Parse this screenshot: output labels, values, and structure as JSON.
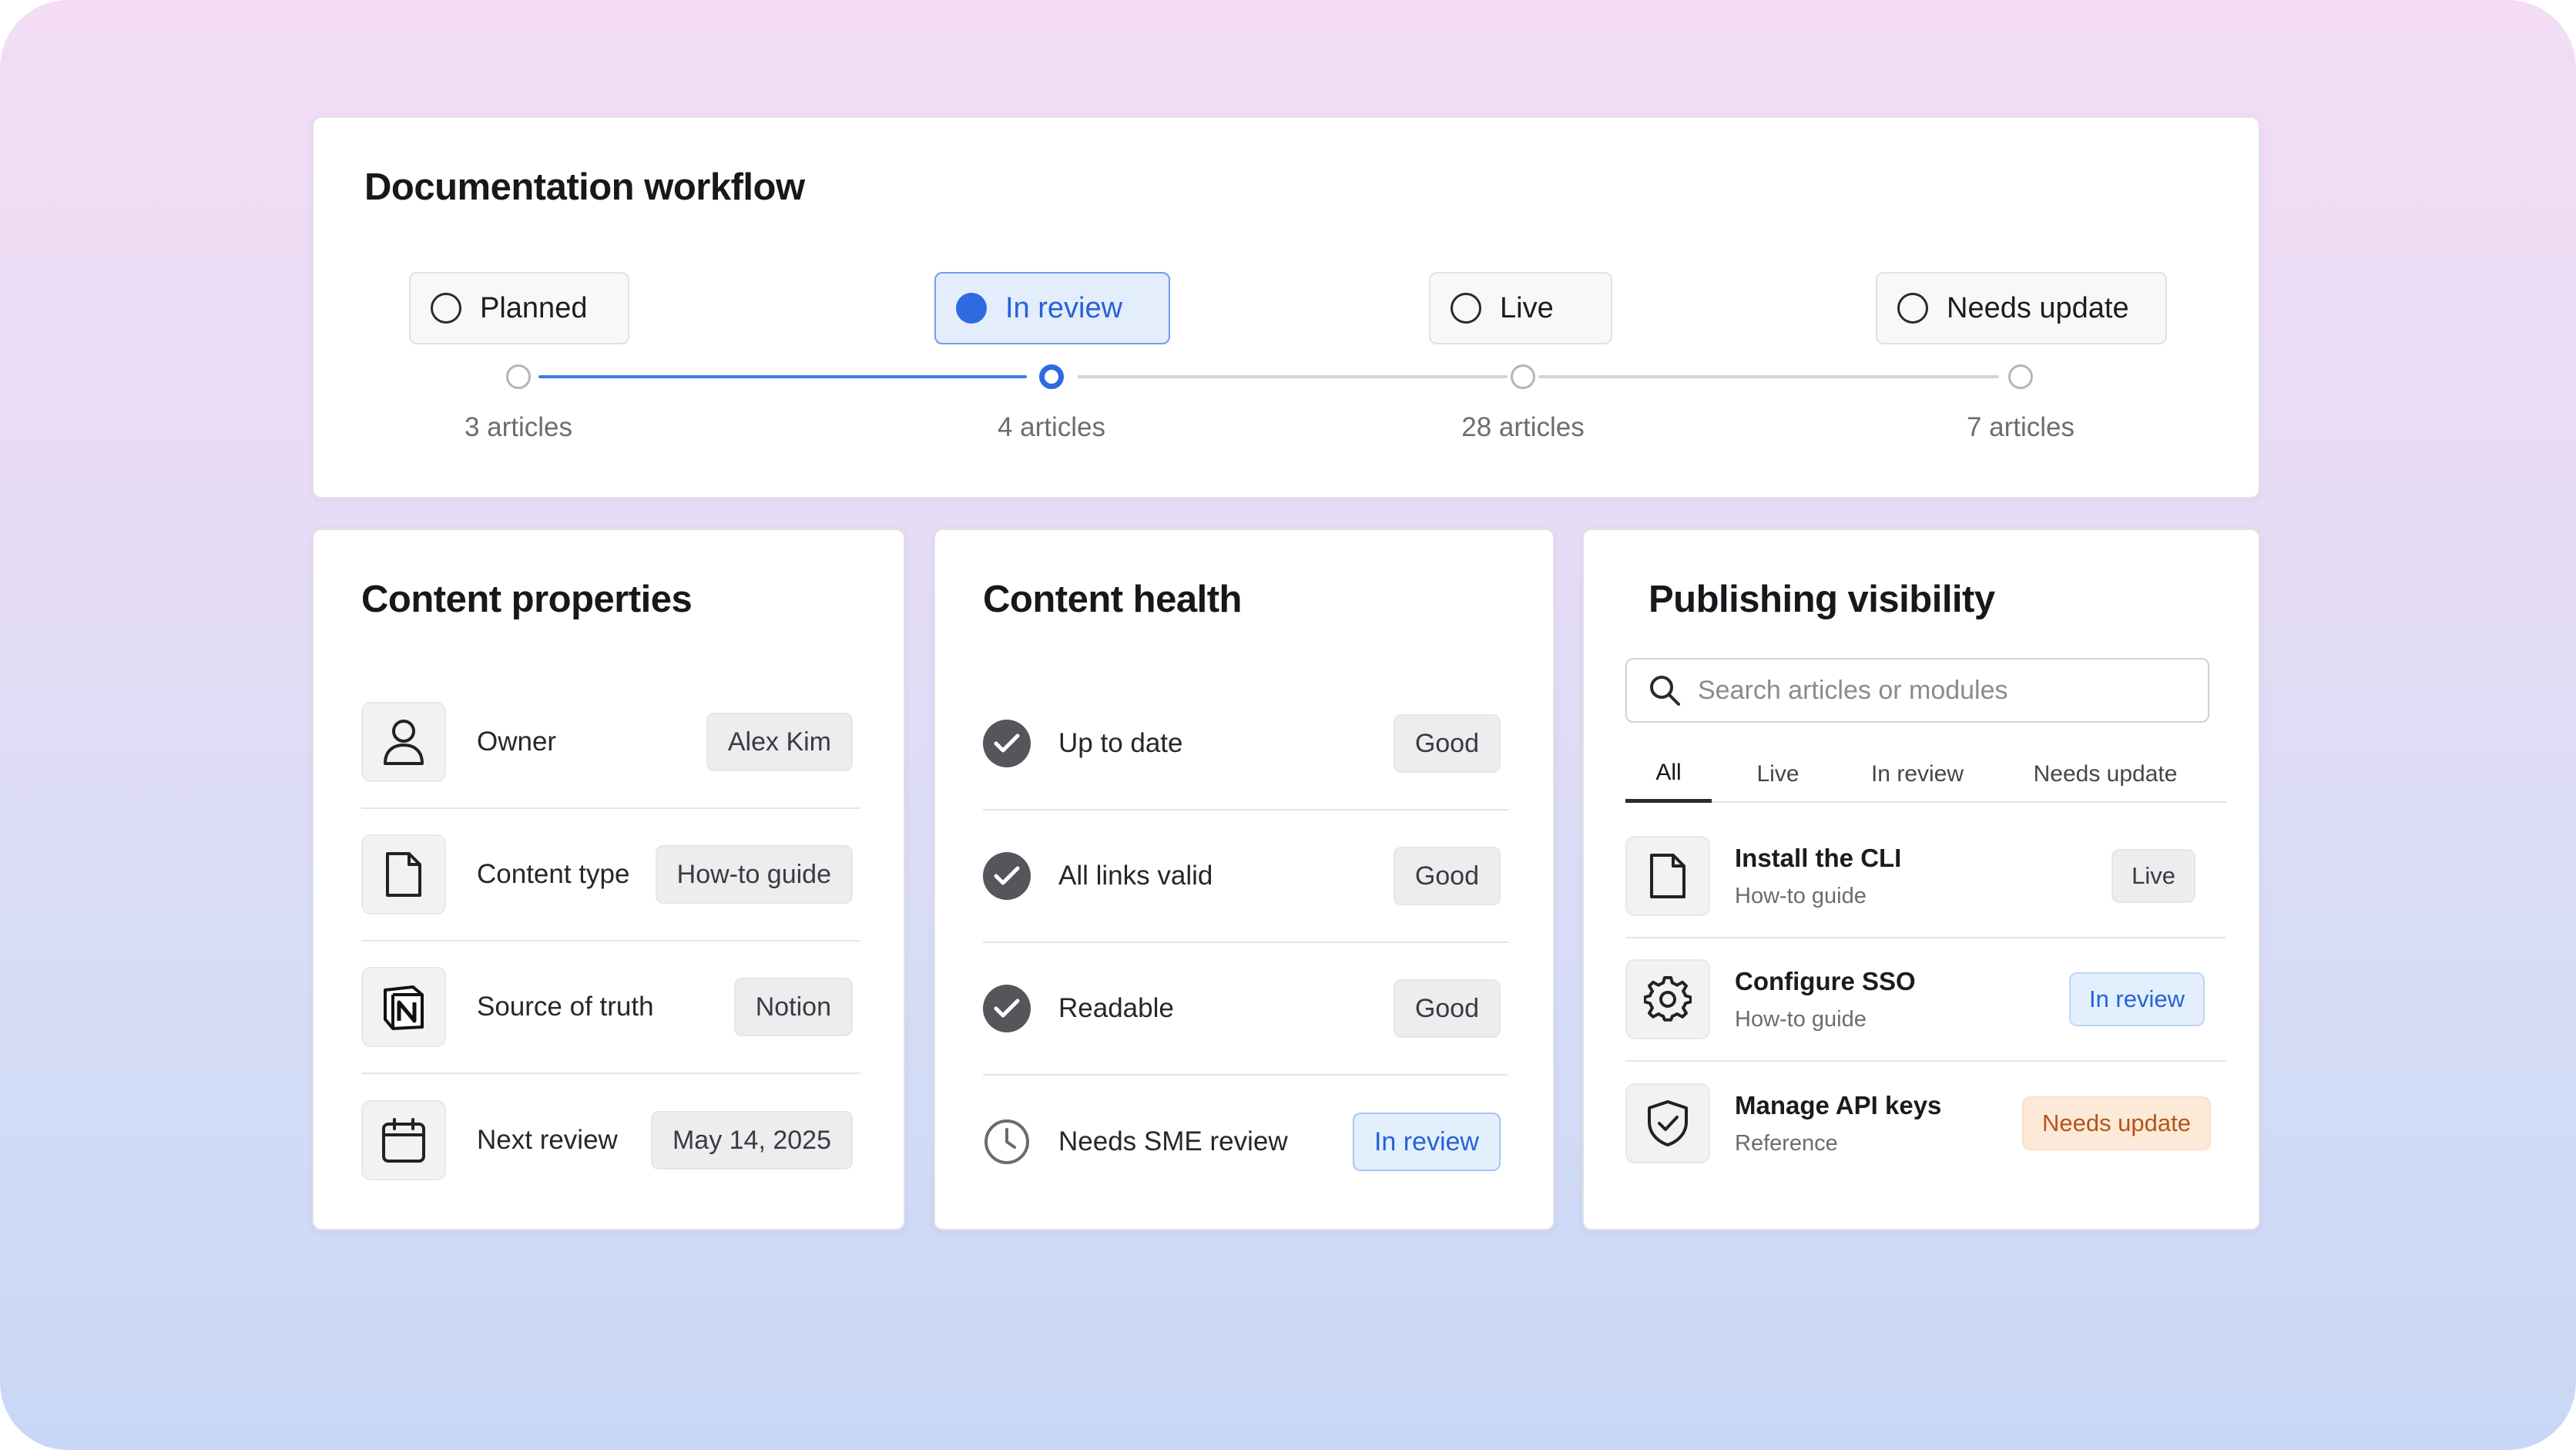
{
  "workflow": {
    "title": "Documentation workflow",
    "active_stage_index": 1,
    "stages": [
      {
        "label": "Planned",
        "count": "3 articles"
      },
      {
        "label": "In review",
        "count": "4 articles"
      },
      {
        "label": "Live",
        "count": "28 articles"
      },
      {
        "label": "Needs update",
        "count": "7 articles"
      }
    ]
  },
  "properties": {
    "title": "Content properties",
    "rows": [
      {
        "icon": "person-icon",
        "label": "Owner",
        "value": "Alex Kim"
      },
      {
        "icon": "document-icon",
        "label": "Content type",
        "value": "How-to guide"
      },
      {
        "icon": "notion-icon",
        "label": "Source of truth",
        "value": "Notion"
      },
      {
        "icon": "calendar-icon",
        "label": "Next review",
        "value": "May 14, 2025"
      }
    ]
  },
  "health": {
    "title": "Content health",
    "rows": [
      {
        "icon": "check-circle-icon",
        "label": "Up to date",
        "status": "Good"
      },
      {
        "icon": "check-circle-icon",
        "label": "All links valid",
        "status": "Good"
      },
      {
        "icon": "check-circle-icon",
        "label": "Readable",
        "status": "Good"
      },
      {
        "icon": "clock-icon",
        "label": "Needs SME review",
        "status": "In review"
      }
    ]
  },
  "publishing": {
    "title": "Publishing visibility",
    "search_placeholder": "Search articles or modules",
    "tabs": [
      "All",
      "Live",
      "In review",
      "Needs update"
    ],
    "active_tab": "All",
    "items": [
      {
        "icon": "document-icon",
        "title": "Install the CLI",
        "type": "How-to guide",
        "status": "Live"
      },
      {
        "icon": "gear-icon",
        "title": "Configure SSO",
        "type": "How-to guide",
        "status": "In review"
      },
      {
        "icon": "shield-check-icon",
        "title": "Manage API keys",
        "type": "Reference",
        "status": "Needs update"
      }
    ]
  },
  "colors": {
    "accent": "#2e6ae0",
    "status_blue_bg": "#e4effd",
    "status_orange_bg": "#fde9d8",
    "status_orange_text": "#b5541a"
  }
}
